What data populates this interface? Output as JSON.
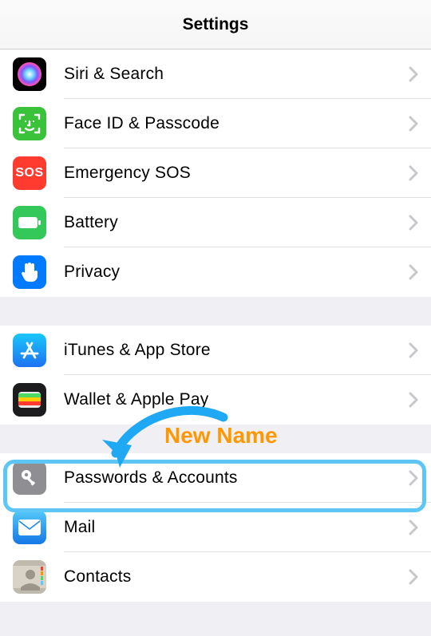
{
  "header": {
    "title": "Settings"
  },
  "groups": [
    {
      "rows": [
        {
          "id": "siri",
          "label": "Siri & Search"
        },
        {
          "id": "faceid",
          "label": "Face ID & Passcode"
        },
        {
          "id": "sos",
          "label": "Emergency SOS"
        },
        {
          "id": "battery",
          "label": "Battery"
        },
        {
          "id": "privacy",
          "label": "Privacy"
        }
      ]
    },
    {
      "rows": [
        {
          "id": "itunes",
          "label": "iTunes & App Store"
        },
        {
          "id": "wallet",
          "label": "Wallet & Apple Pay"
        }
      ]
    },
    {
      "rows": [
        {
          "id": "passwords",
          "label": "Passwords & Accounts"
        },
        {
          "id": "mail",
          "label": "Mail"
        },
        {
          "id": "contacts",
          "label": "Contacts"
        }
      ]
    }
  ],
  "annotation": {
    "label": "New Name",
    "target": "passwords"
  }
}
